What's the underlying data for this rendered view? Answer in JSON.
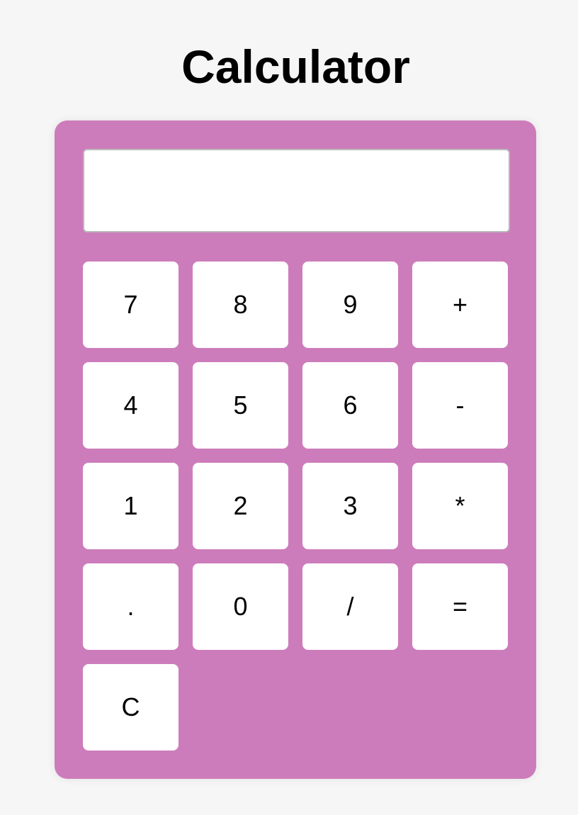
{
  "page": {
    "title": "Calculator"
  },
  "display": {
    "value": "",
    "placeholder": ""
  },
  "keypad": {
    "keys": [
      {
        "label": "7",
        "name": "key-7"
      },
      {
        "label": "8",
        "name": "key-8"
      },
      {
        "label": "9",
        "name": "key-9"
      },
      {
        "label": "+",
        "name": "key-add"
      },
      {
        "label": "4",
        "name": "key-4"
      },
      {
        "label": "5",
        "name": "key-5"
      },
      {
        "label": "6",
        "name": "key-6"
      },
      {
        "label": "-",
        "name": "key-subtract"
      },
      {
        "label": "1",
        "name": "key-1"
      },
      {
        "label": "2",
        "name": "key-2"
      },
      {
        "label": "3",
        "name": "key-3"
      },
      {
        "label": "*",
        "name": "key-multiply"
      },
      {
        "label": ".",
        "name": "key-decimal"
      },
      {
        "label": "0",
        "name": "key-0"
      },
      {
        "label": "/",
        "name": "key-divide"
      },
      {
        "label": "=",
        "name": "key-equals"
      },
      {
        "label": "C",
        "name": "key-clear"
      }
    ]
  },
  "colors": {
    "page_background": "#f6f6f6",
    "calculator_background": "#cd7cbb",
    "key_background": "#ffffff",
    "text": "#000000"
  }
}
